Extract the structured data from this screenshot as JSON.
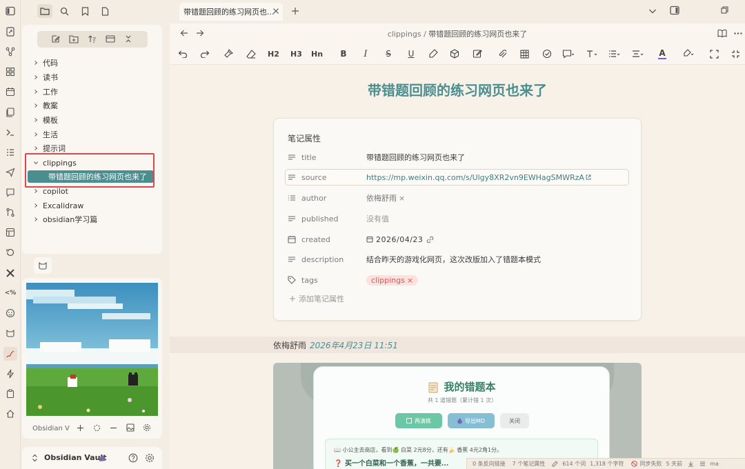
{
  "window": {
    "tab_title": "带错题回顾的练习网页也...",
    "breadcrumb_folder": "clippings",
    "breadcrumb_sep": "/",
    "breadcrumb_file": "带错题回顾的练习网页也来了"
  },
  "toolbar": {
    "h2": "H2",
    "h3": "H3",
    "hn": "Hn",
    "bold": "B",
    "italic": "I",
    "strike": "S",
    "underline": "U",
    "color_a": "A"
  },
  "file_tree": {
    "items": [
      {
        "label": "代码",
        "expanded": false
      },
      {
        "label": "读书",
        "expanded": false
      },
      {
        "label": "工作",
        "expanded": false
      },
      {
        "label": "教案",
        "expanded": false
      },
      {
        "label": "模板",
        "expanded": false
      },
      {
        "label": "生活",
        "expanded": false
      },
      {
        "label": "提示词",
        "expanded": false
      },
      {
        "label": "clippings",
        "expanded": true
      },
      {
        "label": "带错题回顾的练习网页也来了",
        "selected": true
      },
      {
        "label": "copilot",
        "expanded": false
      },
      {
        "label": "Excalidraw",
        "expanded": false
      },
      {
        "label": "obsidian学习篇",
        "expanded": false
      }
    ]
  },
  "media_panel": {
    "label": "Obsidian V"
  },
  "vault": {
    "name": "Obsidian Vault"
  },
  "note": {
    "title": "带错题回顾的练习网页也来了",
    "properties_heading": "笔记属性",
    "properties": {
      "title": {
        "key": "title",
        "value": "带错题回顾的练习网页也来了"
      },
      "source": {
        "key": "source",
        "value": "https://mp.weixin.qq.com/s/Ulgy8XR2vn9EWHagSMWRzA"
      },
      "author": {
        "key": "author",
        "value": "依梅舒雨"
      },
      "published": {
        "key": "published",
        "value": "没有值"
      },
      "created": {
        "key": "created",
        "value": "2026/04/23"
      },
      "description": {
        "key": "description",
        "value": "结合昨天的游戏化网页，这次改版加入了错题本模式"
      },
      "tags": {
        "key": "tags",
        "value": "clippings"
      }
    },
    "remove_mark": "×",
    "add_property": "添加笔记属性",
    "byline_author": "依梅舒雨",
    "byline_date": "2026年4月23日 11:51"
  },
  "embedded": {
    "title": "我的错题本",
    "subtitle": "共 1 道错题（累计错 1 次）",
    "btn_retry": "再演练",
    "btn_export": "导出MD",
    "btn_close": "关闭",
    "line1": "小公主去商店，看到🍏 白菜 2元8分，还有🍌 香蕉 4元2角1分。",
    "line2": "买一个白菜和一个香蕉，一共要..."
  },
  "status_bar": {
    "backlinks": "0 条反向链接",
    "props": "7 个笔记属性",
    "words": "614 个词",
    "chars": "1,318 个字符",
    "sync": "同步失败",
    "sync_time": "5 天前",
    "extra": "ma"
  },
  "colors": {
    "accent": "#4a8e90",
    "highlight_box": "#e0454b",
    "tag_bg": "#fde1de",
    "tag_text": "#d45a5a",
    "background": "#f3ede4"
  }
}
